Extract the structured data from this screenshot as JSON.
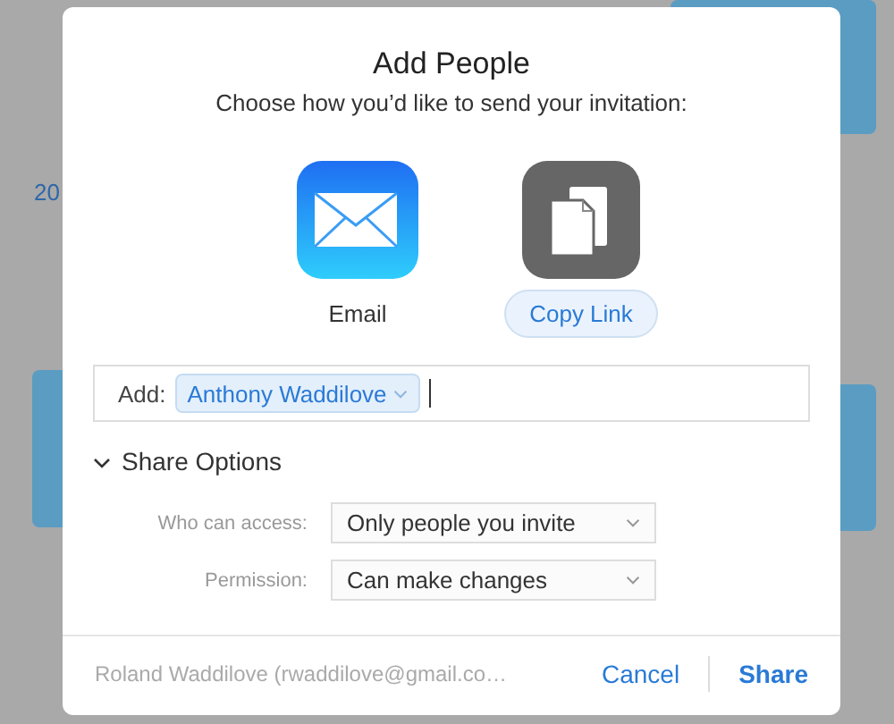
{
  "background": {
    "text": "20"
  },
  "dialog": {
    "title": "Add People",
    "subtitle": "Choose how you’d like to send your invitation:",
    "methods": [
      {
        "kind": "email",
        "label": "Email",
        "selected": false
      },
      {
        "kind": "link",
        "label": "Copy Link",
        "selected": true
      }
    ],
    "add_field": {
      "label": "Add:",
      "tokens": [
        "Anthony Waddilove"
      ]
    },
    "share_options": {
      "label": "Share Options",
      "expanded": true,
      "rows": [
        {
          "label": "Who can access:",
          "value": "Only people you invite"
        },
        {
          "label": "Permission:",
          "value": "Can make changes"
        }
      ]
    },
    "footer": {
      "owner": "Roland Waddilove (rwaddilove@gmail.co…",
      "buttons": [
        "Cancel",
        "Share"
      ]
    }
  }
}
